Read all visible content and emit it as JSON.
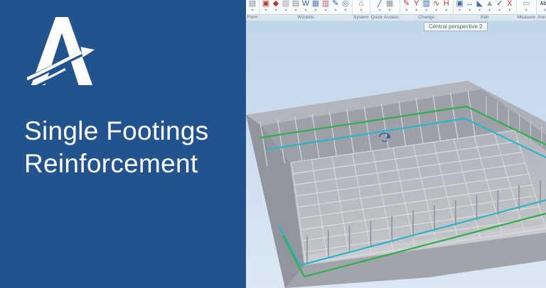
{
  "left_panel": {
    "background_color": "#22538e",
    "logo": "allplan-logo",
    "title_line1": "Single Footings",
    "title_line2": "Reinforcement",
    "text_color": "#ffffff"
  },
  "toolbar": {
    "dropdown_arrow": "▾",
    "groups": [
      {
        "label": "Form",
        "icons": [
          {
            "name": "clipboard-icon",
            "glyph": "▤",
            "color": "#6f7f95"
          }
        ]
      },
      {
        "label": "Wizards",
        "icons": [
          {
            "name": "stamp-icon",
            "glyph": "▣",
            "color": "#b23a2f"
          },
          {
            "name": "ink-bottle-icon",
            "glyph": "◆",
            "color": "#b23a2f"
          },
          {
            "name": "eraser-icon",
            "glyph": "▨",
            "color": "#98a0aa"
          },
          {
            "name": "printer-icon",
            "glyph": "▤",
            "color": "#868c96"
          },
          {
            "name": "word-export-icon",
            "glyph": "W",
            "color": "#2f5fa5"
          },
          {
            "name": "layers-icon",
            "glyph": "▦",
            "color": "#5b7fb0"
          },
          {
            "name": "report-icon",
            "glyph": "▥",
            "color": "#c05575"
          },
          {
            "name": "pen-document-icon",
            "glyph": "✎",
            "color": "#2f5fa5"
          },
          {
            "name": "globe-icon",
            "glyph": "◎",
            "color": "#4a79b4"
          }
        ]
      },
      {
        "label": "System",
        "icons": [
          {
            "name": "home-icon",
            "glyph": "⌂",
            "color": "#5f6e80"
          }
        ]
      },
      {
        "label": "Quick Access",
        "icons": [
          {
            "name": "draw-line-icon",
            "glyph": "╱",
            "color": "#4a5a6a"
          },
          {
            "name": "hatch-icon",
            "glyph": "▦",
            "color": "#8a93a0"
          }
        ]
      },
      {
        "label": "Change",
        "icons": [
          {
            "name": "edit-pencil-icon",
            "glyph": "✎",
            "color": "#b23a2f"
          },
          {
            "name": "split-icon",
            "glyph": "Y",
            "color": "#b23a2f"
          },
          {
            "name": "modify-box-icon",
            "glyph": "▥",
            "color": "#2f5fa5"
          },
          {
            "name": "curve-icon",
            "glyph": "∿",
            "color": "#b23a2f"
          },
          {
            "name": "lift-icon",
            "glyph": "H",
            "color": "#b23a2f"
          }
        ]
      },
      {
        "label": "Edit",
        "icons": [
          {
            "name": "copy-icon",
            "glyph": "▣",
            "color": "#3f6ba8"
          },
          {
            "name": "stretch-icon",
            "glyph": "↔",
            "color": "#3f6ba8"
          },
          {
            "name": "corner-icon",
            "glyph": "◣",
            "color": "#3f6ba8"
          },
          {
            "name": "cone-icon",
            "glyph": "▲",
            "color": "#8a93a0"
          },
          {
            "name": "checklist-icon",
            "glyph": "✓",
            "color": "#3d4f66"
          },
          {
            "name": "delete-icon",
            "glyph": "X",
            "color": "#c0392b"
          }
        ]
      },
      {
        "label": "Measure",
        "icons": [
          {
            "name": "ruler-icon",
            "glyph": "▭",
            "color": "#8a93a0"
          }
        ]
      },
      {
        "label": "Annotations",
        "icons": [
          {
            "name": "text-abc-icon",
            "glyph": "Abc",
            "color": "#3d4f66"
          },
          {
            "name": "image-frame-icon",
            "glyph": "▣",
            "color": "#8a93a0"
          }
        ]
      }
    ]
  },
  "viewport": {
    "tooltip": "Central perspective 2",
    "sky_top": "#c2d6ea",
    "sky_bottom": "#dbe7f4",
    "slab_gray": "#a4a7ae",
    "floor_gray_back": "#acafb6",
    "floor_gray_front": "#c3c5ca",
    "mesh_line": "#e0e2e6",
    "rebar_green": "#2fb04c",
    "rebar_cyan": "#28b7c9",
    "nav_widget_color": "#3c5f98"
  }
}
